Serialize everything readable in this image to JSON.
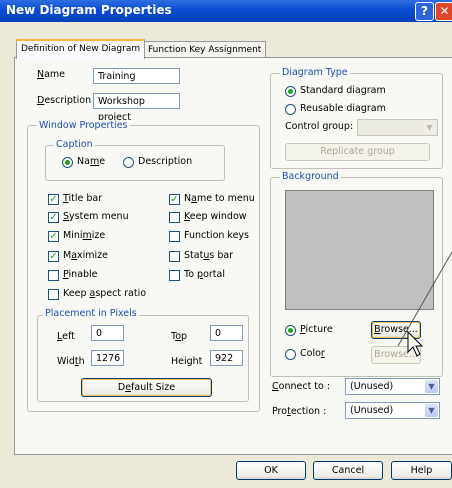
{
  "window": {
    "title": "New Diagram Properties"
  },
  "tabs": [
    {
      "label": "Definition of New Diagram"
    },
    {
      "label": "Function Key Assignment"
    }
  ],
  "fields": {
    "name_label": "Name",
    "name_value": "Training",
    "description_label": "Description",
    "description_value": "Workshop project"
  },
  "window_properties": {
    "title": "Window Properties",
    "caption_title": "Caption",
    "caption_name": "Name",
    "caption_description": "Description",
    "checkboxes": {
      "title_bar": "Title bar",
      "system_menu": "System menu",
      "minimize": "Minimize",
      "maximize": "Maximize",
      "pinable": "Pinable",
      "keep_aspect_ratio": "Keep aspect ratio",
      "name_to_menu": "Name to menu",
      "keep_window": "Keep window",
      "function_keys": "Function keys",
      "status_bar": "Status bar",
      "to_portal": "To portal"
    },
    "placement_title": "Placement in Pixels",
    "left_label": "Left",
    "left_value": "0",
    "top_label": "Top",
    "top_value": "0",
    "width_label": "Width",
    "width_value": "1276",
    "height_label": "Height",
    "height_value": "922",
    "default_size": "Default Size"
  },
  "diagram_type": {
    "title": "Diagram Type",
    "standard": "Standard diagram",
    "reusable": "Reusable diagram",
    "control_group_label": "Control group:",
    "replicate_group": "Replicate group"
  },
  "background": {
    "title": "Background",
    "picture": "Picture",
    "color": "Color",
    "browse": "Browse...",
    "browse2": "Browse..."
  },
  "connect_to": {
    "label": "Connect to :",
    "value": "(Unused)"
  },
  "protection": {
    "label": "Protection :",
    "value": "(Unused)"
  },
  "footer": {
    "ok": "OK",
    "cancel": "Cancel",
    "help": "Help"
  }
}
